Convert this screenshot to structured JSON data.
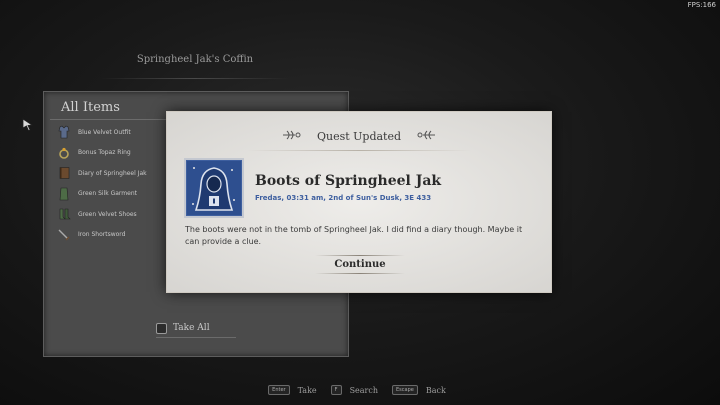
{
  "hud": {
    "fps": "FPS:166"
  },
  "container": {
    "title": "Springheel Jak's Coffin"
  },
  "inventory": {
    "header": "All Items",
    "items": [
      {
        "label": "Blue Velvet Outfit",
        "icon": "outfit-icon"
      },
      {
        "label": "Bonus Topaz Ring",
        "icon": "ring-icon"
      },
      {
        "label": "Diary of Springheel Jak",
        "icon": "book-icon"
      },
      {
        "label": "Green Silk Garment",
        "icon": "garment-icon"
      },
      {
        "label": "Green Velvet Shoes",
        "icon": "shoes-icon"
      },
      {
        "label": "Iron Shortsword",
        "icon": "sword-icon"
      }
    ],
    "take_all_label": "Take All"
  },
  "dialog": {
    "header": "Quest Updated",
    "quest_title": "Boots of Springheel Jak",
    "date": "Fredas, 03:31 am, 2nd of Sun's Dusk, 3E 433",
    "body": "The boots were not in the tomb of Springheel Jak. I did find a diary though. Maybe it can provide a clue.",
    "continue_label": "Continue"
  },
  "footer": {
    "hints": [
      {
        "key": "Enter",
        "label": "Take"
      },
      {
        "key": "F",
        "label": "Search"
      },
      {
        "key": "Escape",
        "label": "Back"
      }
    ]
  },
  "colors": {
    "accent_blue": "#3e5f9f",
    "parchment": "#e9e7e3"
  }
}
